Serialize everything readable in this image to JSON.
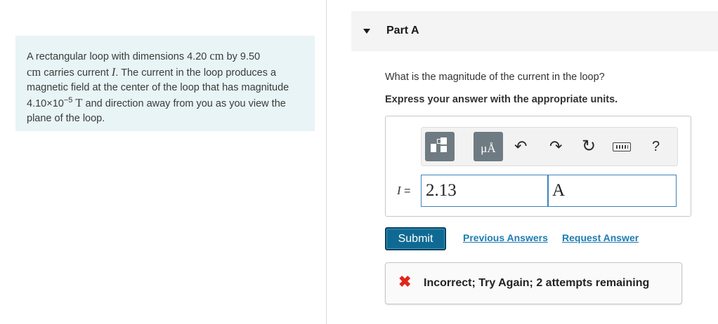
{
  "problem": {
    "intro": "A rectangular loop with dimensions ",
    "dim1_value": "4.20",
    "dim1_unit": "cm",
    "by": " by ",
    "dim2_value": "9.50",
    "dim2_unit": "cm",
    "carries": " carries current ",
    "current_symbol": "I",
    "middle": ". The current in the loop produces a magnetic field at the center of the loop that has magnitude ",
    "field_mantissa": "4.10×10",
    "field_exponent": "−5",
    "field_unit": "T",
    "ending": " and direction away from you as you view the plane of the loop."
  },
  "part": {
    "title": "Part A"
  },
  "question": "What is the magnitude of the current in the loop?",
  "instruction": "Express your answer with the appropriate units.",
  "toolbar": {
    "units_label": "μÅ",
    "icons": [
      "templates-icon",
      "units-icon",
      "undo-icon",
      "redo-icon",
      "reset-icon",
      "keyboard-icon",
      "help-icon"
    ],
    "undo_glyph": "↶",
    "redo_glyph": "↷",
    "reset_glyph": "↻",
    "help_glyph": "?"
  },
  "answer": {
    "variable": "I",
    "equals": " = ",
    "value": "2.13",
    "units": "A"
  },
  "buttons": {
    "submit": "Submit",
    "previous_answers": "Previous Answers",
    "request_answer": "Request Answer"
  },
  "feedback": {
    "icon": "✖",
    "message": "Incorrect; Try Again; 2 attempts remaining",
    "color": "#e0261b"
  },
  "colors": {
    "panel_bg": "#e8f4f6",
    "submit_bg": "#0f6a93",
    "link": "#1d7cb0",
    "input_border": "#3b83bd"
  }
}
